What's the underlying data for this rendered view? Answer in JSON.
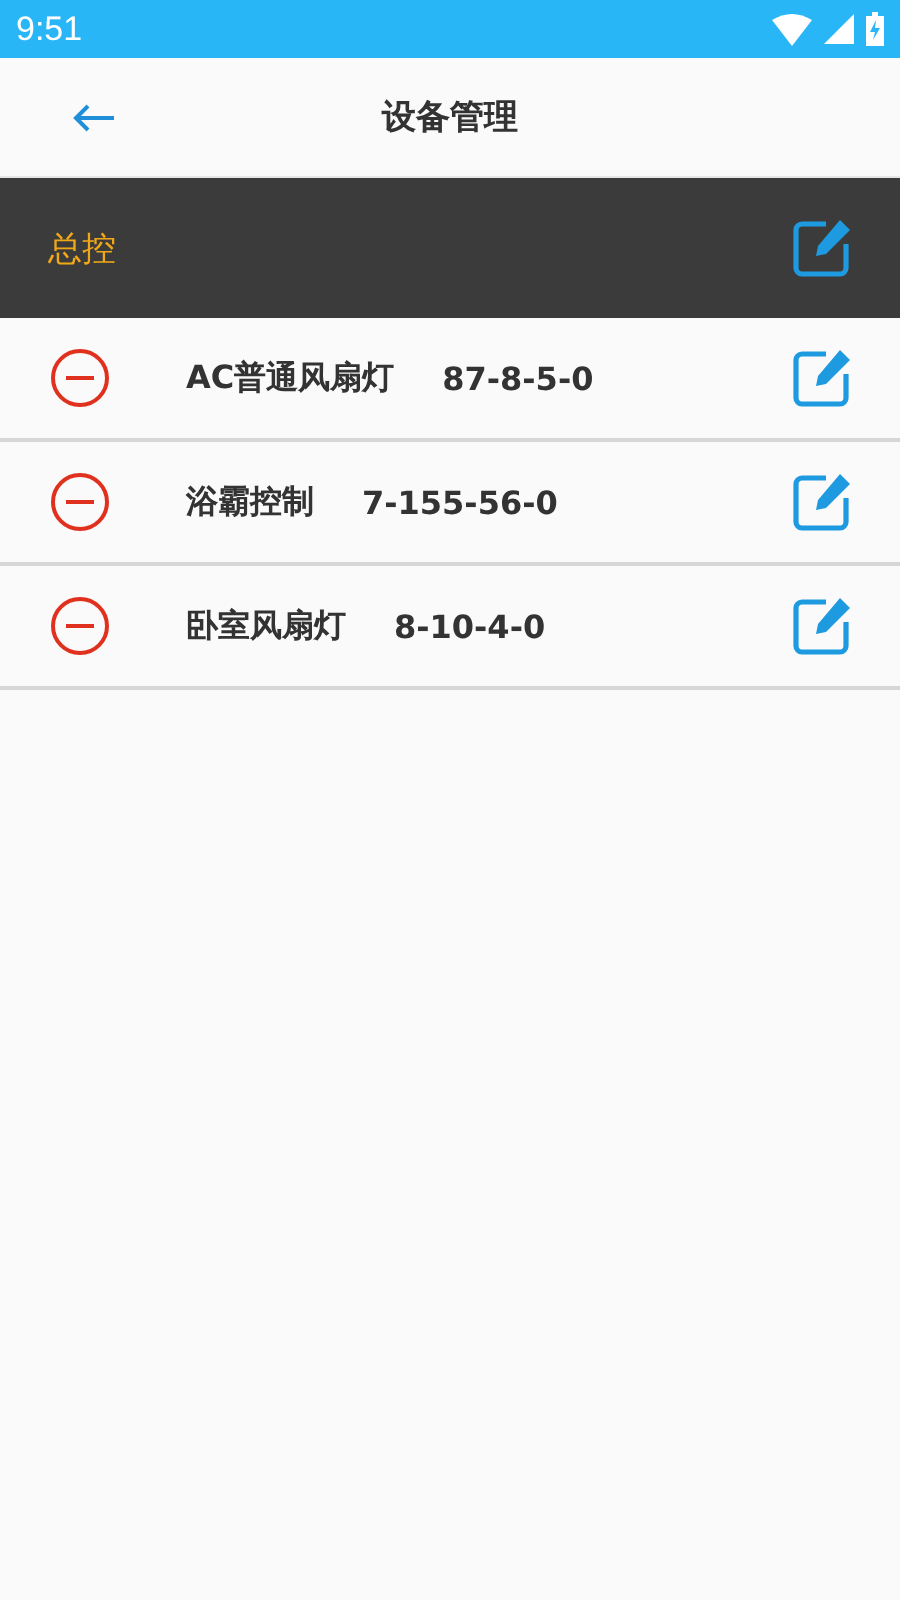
{
  "status_bar": {
    "time": "9:51"
  },
  "header": {
    "title": "设备管理"
  },
  "master": {
    "label": "总控"
  },
  "devices": [
    {
      "name": "AC普通风扇灯",
      "code": "87-8-5-0"
    },
    {
      "name": "浴霸控制",
      "code": "7-155-56-0"
    },
    {
      "name": "卧室风扇灯",
      "code": "8-10-4-0"
    }
  ]
}
